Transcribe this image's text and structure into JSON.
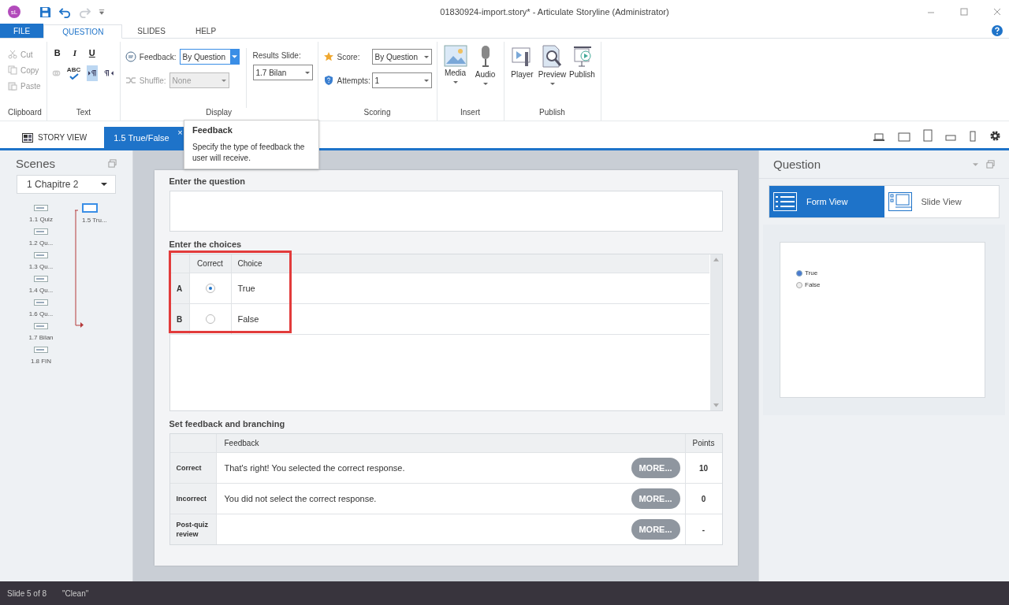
{
  "window": {
    "app_badge": "sL",
    "title": "01830924-import.story* - Articulate Storyline (Administrator)"
  },
  "ribbon_tabs": [
    {
      "label": "FILE",
      "kind": "file",
      "selected": false
    },
    {
      "label": "QUESTION",
      "kind": "tab",
      "selected": true
    },
    {
      "label": "SLIDES",
      "kind": "tab",
      "selected": false
    },
    {
      "label": "HELP",
      "kind": "tab",
      "selected": false
    }
  ],
  "clipboard": {
    "items": [
      {
        "label": "Cut",
        "kind": "cut",
        "disabled": true
      },
      {
        "label": "Copy",
        "kind": "copy",
        "disabled": true
      },
      {
        "label": "Paste",
        "kind": "paste",
        "disabled": true
      }
    ],
    "group_label": "Clipboard"
  },
  "text_group": {
    "format_buttons": [
      "B",
      "I",
      "U"
    ],
    "spell_label": "ABC",
    "ltr_selected": true,
    "group_label": "Text"
  },
  "display": {
    "feedback": {
      "label": "Feedback:",
      "value": "By Question",
      "focused": true
    },
    "shuffle": {
      "label": "Shuffle:",
      "value": "None",
      "disabled": true
    },
    "results_slide": {
      "label": "Results Slide:",
      "value": "1.7 Bilan"
    },
    "group_label": "Display"
  },
  "scoring": {
    "score": {
      "label": "Score:",
      "value": "By Question"
    },
    "attempts": {
      "label": "Attempts:",
      "value": "1"
    },
    "group_label": "Scoring"
  },
  "insert": {
    "buttons": [
      {
        "label": "Media",
        "kind": "media"
      },
      {
        "label": "Audio",
        "kind": "audio"
      }
    ],
    "group_label": "Insert"
  },
  "publish": {
    "buttons": [
      {
        "label": "Player",
        "kind": "player",
        "dropdown": false
      },
      {
        "label": "Preview",
        "kind": "preview",
        "dropdown": true
      },
      {
        "label": "Publish",
        "kind": "publish",
        "dropdown": false
      }
    ],
    "group_label": "Publish"
  },
  "doc_tabs": [
    {
      "label": "STORY VIEW",
      "selected": false,
      "closable": false
    },
    {
      "label": "1.5 True/False",
      "selected": true,
      "closable": true
    }
  ],
  "close_glyph": "×",
  "tooltip": {
    "title": "Feedback",
    "text": "Specify the type of feedback the user will receive."
  },
  "scenes": {
    "title": "Scenes",
    "dropdown": "1 Chapitre 2",
    "slides": [
      {
        "label": "1.1 Quiz"
      },
      {
        "label": "1.2 Qu..."
      },
      {
        "label": "1.3 Qu..."
      },
      {
        "label": "1.4 Qu..."
      },
      {
        "label": "1.6 Qu..."
      },
      {
        "label": "1.7 Bilan"
      },
      {
        "label": "1.8 FIN"
      }
    ],
    "branch_slide": {
      "label": "1.5 Tru...",
      "selected": true
    }
  },
  "question": {
    "label": "Enter the question",
    "choices_label": "Enter the choices",
    "choice_columns": [
      "Correct",
      "Choice"
    ],
    "choices": [
      {
        "letter": "A",
        "text": "True",
        "selected": true
      },
      {
        "letter": "B",
        "text": "False",
        "selected": false
      }
    ],
    "feedback_label": "Set feedback and branching",
    "feedback_columns": [
      "Feedback",
      "Points"
    ],
    "feedback_rows": [
      {
        "label": "Correct",
        "text": "That's right!  You selected the correct response.",
        "more": "MORE...",
        "points": "10"
      },
      {
        "label": "Incorrect",
        "text": "You did not select the correct response.",
        "more": "MORE...",
        "points": "0"
      },
      {
        "label": "Post-quiz review",
        "more": "MORE...",
        "points": "-"
      }
    ]
  },
  "right_panel": {
    "title": "Question",
    "views": [
      {
        "label": "Form View",
        "selected": true
      },
      {
        "label": "Slide View",
        "selected": false
      }
    ],
    "preview_options": [
      {
        "text": "True",
        "selected": true
      },
      {
        "text": "False",
        "selected": false
      }
    ]
  },
  "status_bar": {
    "slide": "Slide 5 of 8",
    "theme": "\"Clean\""
  }
}
